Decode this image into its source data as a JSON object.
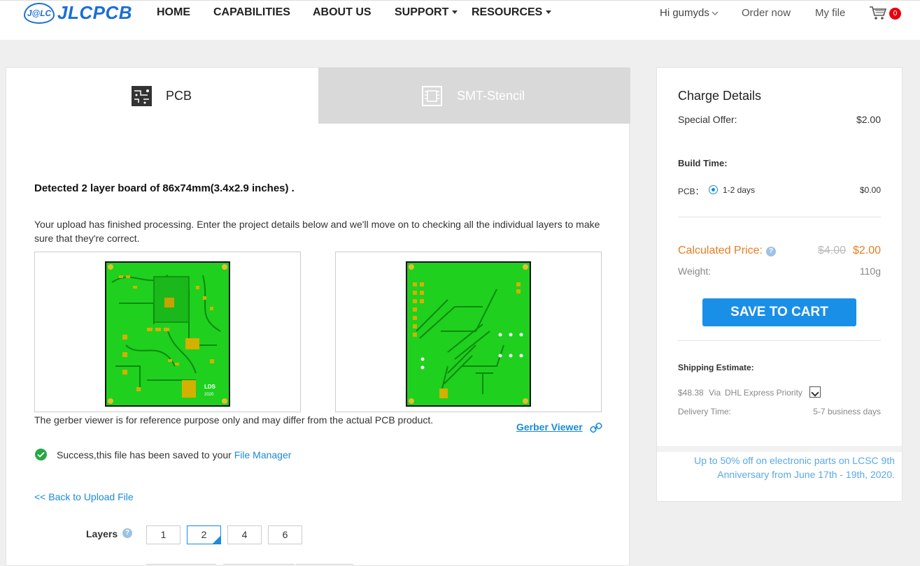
{
  "header": {
    "logo_mark": "J@LC",
    "logo_text": "JLCPCB",
    "nav": {
      "home": "HOME",
      "capabilities": "CAPABILITIES",
      "about": "ABOUT US",
      "support": "SUPPORT",
      "resources": "RESOURCES"
    },
    "greeting": "Hi gumyds",
    "order_now": "Order now",
    "my_file": "My file",
    "cart_count": "0"
  },
  "tabs": {
    "pcb": "PCB",
    "stencil": "SMT-Stencil"
  },
  "main": {
    "detected": "Detected 2 layer board of 86x74mm(3.4x2.9 inches) .",
    "upload_message": "Your upload has finished processing. Enter the project details below and we'll move on to checking all the individual layers to make sure that they're correct.",
    "reference_note": "The gerber viewer is for reference purpose only and may differ from the actual PCB product.",
    "gerber_viewer_link": "Gerber Viewer",
    "success_prefix": "Success,this file has been saved to your ",
    "file_manager_link": "File Manager",
    "back_link": "<< Back to Upload File",
    "pcb_silk_label": "LDS",
    "pcb_silk_year": "2020",
    "layers": {
      "label": "Layers",
      "options": [
        "1",
        "2",
        "4",
        "6"
      ],
      "selected": "2"
    }
  },
  "charge": {
    "title": "Charge Details",
    "special_offer_label": "Special Offer:",
    "special_offer_value": "$2.00",
    "build_time_label": "Build Time:",
    "pcb_label": "PCB：",
    "build_option": "1-2 days",
    "build_price": "$0.00",
    "calculated_label": "Calculated Price:",
    "old_price": "$4.00",
    "new_price": "$2.00",
    "weight_label": "Weight:",
    "weight_value": "110g",
    "save_to_cart": "SAVE TO CART",
    "shipping_label": "Shipping Estimate:",
    "shipping_cost": "$48.38",
    "shipping_via": "Via",
    "shipping_method": "DHL Express Priority",
    "delivery_label": "Delivery Time:",
    "delivery_value": "5-7 business days",
    "promo": "Up to 50% off on electronic parts on LCSC 9th Anniversary from June 17th - 19th, 2020."
  },
  "colors": {
    "brand_blue": "#1a6fd4",
    "link_blue": "#1a8adb",
    "price_orange": "#e67e22",
    "pcb_green": "#1fd01f",
    "cart_badge_red": "#e60012"
  }
}
